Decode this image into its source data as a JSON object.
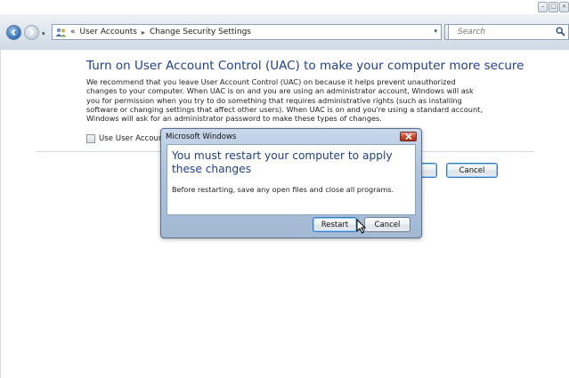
{
  "window": {
    "caption_buttons": [
      "minimize",
      "maximize",
      "close"
    ]
  },
  "address_bar": {
    "prefix": "«",
    "breadcrumbs": [
      "User Accounts",
      "Change Security Settings"
    ],
    "separator": "▸",
    "icon": "user-accounts-icon"
  },
  "search": {
    "placeholder": "Search",
    "icon": "magnifier-icon"
  },
  "page": {
    "heading": "Turn on User Account Control (UAC) to make your computer more secure",
    "description": "We recommend that you leave User Account Control (UAC) on because it helps prevent unauthorized changes to your computer.  When UAC is on and you are using an administrator account, Windows will ask you for permission when you try to do something that requires administrative rights (such as installing software or changing settings that affect other users).  When UAC is on and you're using a standard account, Windows will ask for an administrator password to make these types of changes.",
    "checkbox_label": "Use User Account",
    "checkbox_checked": false,
    "cancel_label": "Cancel"
  },
  "dialog": {
    "title": "Microsoft Windows",
    "heading": "You must restart your computer to apply these changes",
    "message": "Before restarting, save any open files and close all programs.",
    "restart_label": "Restart",
    "cancel_label": "Cancel",
    "close_icon": "close-icon"
  },
  "colors": {
    "accent_heading": "#1e3f8f",
    "dialog_frame": "#aec3dc",
    "close_button": "#c8432c"
  }
}
